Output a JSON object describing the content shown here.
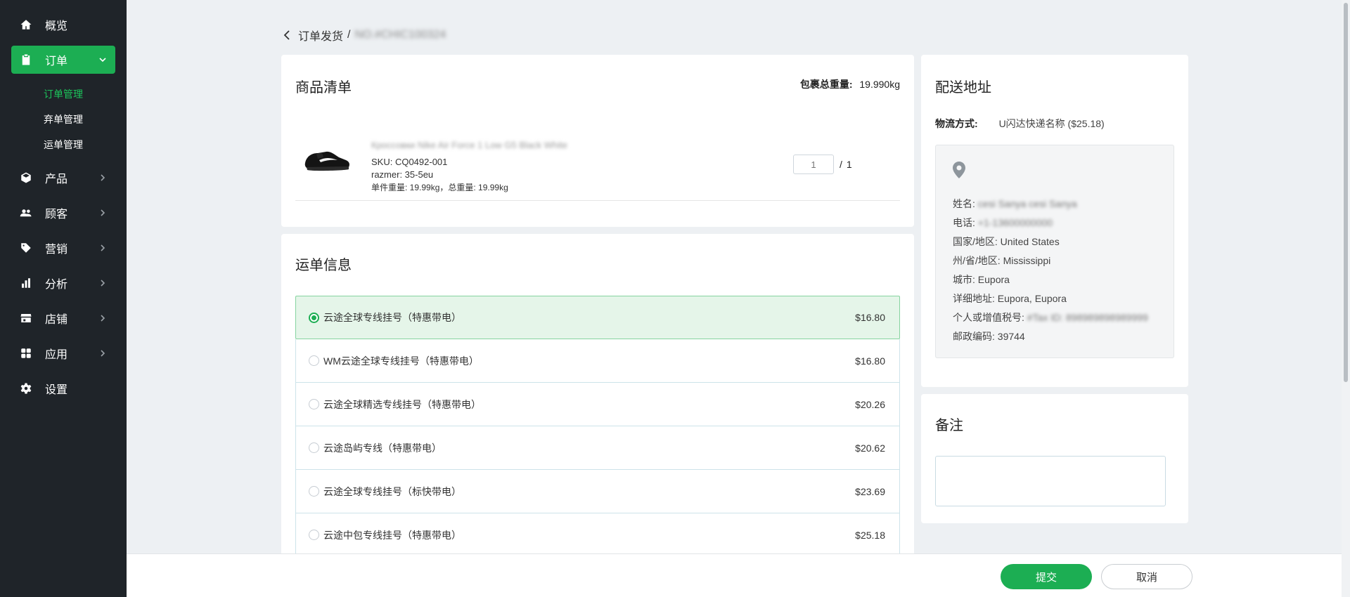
{
  "sidebar": {
    "items": [
      {
        "label": "概览",
        "icon": "home-icon"
      },
      {
        "label": "订单",
        "icon": "clipboard-icon"
      },
      {
        "label": "产品",
        "icon": "cube-icon"
      },
      {
        "label": "顾客",
        "icon": "users-icon"
      },
      {
        "label": "营销",
        "icon": "tag-icon"
      },
      {
        "label": "分析",
        "icon": "bar-chart-icon"
      },
      {
        "label": "店铺",
        "icon": "store-icon"
      },
      {
        "label": "应用",
        "icon": "apps-icon"
      },
      {
        "label": "设置",
        "icon": "gear-icon"
      }
    ],
    "sub_items": [
      "订单管理",
      "弃单管理",
      "运单管理"
    ],
    "active_color": "#1cae53"
  },
  "breadcrumb": {
    "parent": "订单发货",
    "separator": "/",
    "current": "NO.#CHIC100324"
  },
  "products": {
    "title": "商品清单",
    "total_weight_label": "包裹总重量:",
    "total_weight_value": "19.990kg",
    "item": {
      "name": "Кроссовки Nike Air Force 1 Low G5 Black White",
      "sku": "SKU: CQ0492-001",
      "variant": "razmer: 35-5eu",
      "weight": "单件重量: 19.99kg，总重量: 19.99kg",
      "qty_placeholder": "1",
      "qty_separator": "/",
      "qty_total": "1"
    }
  },
  "shipping": {
    "title": "运单信息",
    "options": [
      {
        "name": "云途全球专线挂号（特惠带电）",
        "price": "$16.80",
        "selected": true
      },
      {
        "name": "WM云途全球专线挂号（特惠带电）",
        "price": "$16.80",
        "selected": false
      },
      {
        "name": "云途全球精选专线挂号（特惠带电）",
        "price": "$20.26",
        "selected": false
      },
      {
        "name": "云途岛屿专线（特惠带电）",
        "price": "$20.62",
        "selected": false
      },
      {
        "name": "云途全球专线挂号（标快带电）",
        "price": "$23.69",
        "selected": false
      },
      {
        "name": "云途中包专线挂号（特惠带电）",
        "price": "$25.18",
        "selected": false
      }
    ]
  },
  "address": {
    "title": "配送地址",
    "method_label": "物流方式:",
    "method_value": "U闪达快递名称 ($25.18)",
    "lines": {
      "name_label": "姓名:",
      "name_value": "cesi Sanya cesi Sanya",
      "phone_label": "电话:",
      "phone_value": "+1-13600000000",
      "country_label": "国家/地区:",
      "country_value": "United States",
      "state_label": "州/省/地区:",
      "state_value": "Mississippi",
      "city_label": "城市:",
      "city_value": "Eupora",
      "detail_label": "详细地址:",
      "detail_value": "Eupora, Eupora",
      "tax_label": "个人或增值税号:",
      "tax_value": "#Tax ID: 898989898989999",
      "zip_label": "邮政编码:",
      "zip_value": "39744"
    }
  },
  "remark": {
    "title": "备注"
  },
  "footer": {
    "submit_label": "提交",
    "cancel_label": "取消"
  }
}
